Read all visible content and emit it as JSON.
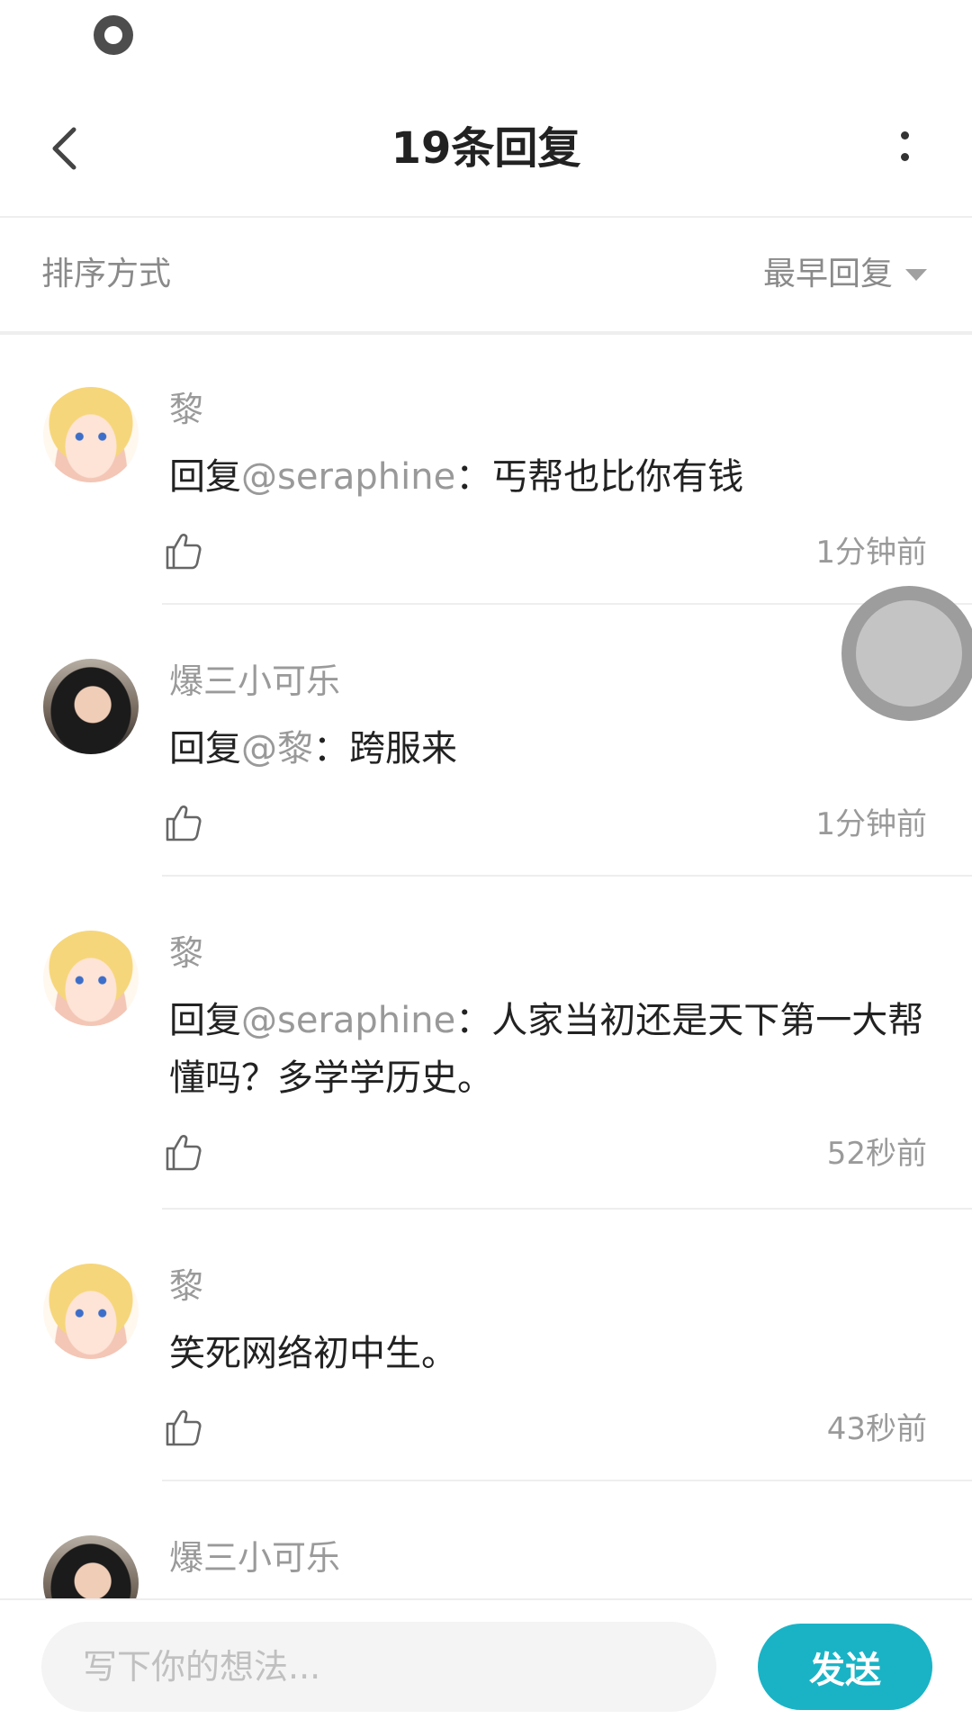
{
  "header": {
    "title": "19条回复"
  },
  "sort": {
    "label": "排序方式",
    "value": "最早回复"
  },
  "comments": [
    {
      "username": "黎",
      "reply_prefix": "回复",
      "mention": "@seraphine",
      "text": "：丐帮也比你有钱",
      "time": "1分钟前",
      "avatar": "anime-girl-avatar"
    },
    {
      "username": "爆三小可乐",
      "reply_prefix": "回复",
      "mention": "@黎",
      "text": "：跨服来",
      "time": "1分钟前",
      "avatar": "photo-avatar"
    },
    {
      "username": "黎",
      "reply_prefix": "回复",
      "mention": "@seraphine",
      "text": "：人家当初还是天下第一大帮 懂吗？多学学历史。",
      "time": "52秒前",
      "avatar": "anime-girl-avatar"
    },
    {
      "username": "黎",
      "text": "笑死网络初中生。",
      "time": "43秒前",
      "avatar": "anime-girl-avatar"
    },
    {
      "username": "爆三小可乐",
      "avatar": "photo-avatar"
    }
  ],
  "composer": {
    "placeholder": "写下你的想法...",
    "send_label": "发送"
  },
  "icons": {
    "back": "chevron-left-icon",
    "more": "more-vertical-icon",
    "sort_caret": "caret-down-icon",
    "like": "thumbs-up-icon"
  },
  "colors": {
    "accent": "#1ab3c6",
    "mention": "#999999",
    "text": "#222222",
    "muted": "#9a9a9a"
  }
}
